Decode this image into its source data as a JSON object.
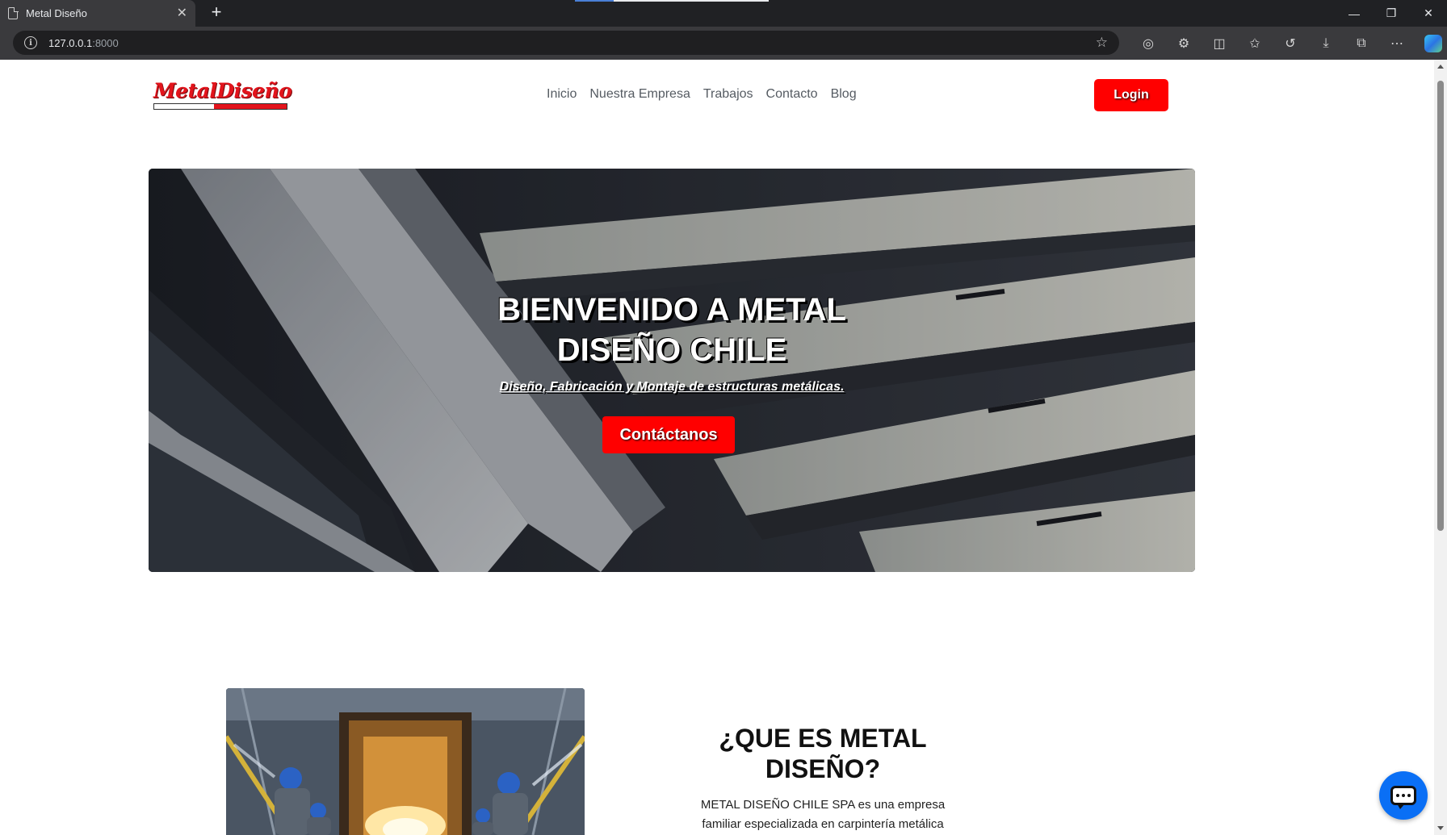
{
  "browser": {
    "tab_title": "Metal Diseño",
    "url_host": "127.0.0.1",
    "url_port": ":8000",
    "new_tab_glyph": "+",
    "close_glyph": "✕"
  },
  "icons": {
    "tab_page": "page-icon",
    "site_info": "info-icon",
    "favorite": "star-icon",
    "toolbar": [
      "tracking-icon",
      "extensions-icon",
      "split-screen-icon",
      "favorites-icon",
      "history-icon",
      "download-icon",
      "screenshot-icon",
      "more-icon",
      "copilot-icon"
    ],
    "chat": "chat-icon"
  },
  "colors": {
    "brand_red": "#ff0000",
    "logo_red": "#e3141c",
    "chat_blue": "#0a6ff5",
    "nav_text": "#555b62"
  },
  "header": {
    "logo_text": "MetalDiseño",
    "nav": [
      "Inicio",
      "Nuestra Empresa",
      "Trabajos",
      "Contacto",
      "Blog"
    ],
    "login_label": "Login"
  },
  "hero": {
    "title_line1": "BIENVENIDO A METAL",
    "title_line2": "DISEÑO CHILE",
    "subtitle": "Diseño, Fabricación y Montaje de estructuras metálicas.",
    "cta_label": "Contáctanos"
  },
  "about": {
    "title_line1": "¿QUE ES METAL",
    "title_line2": "DISEÑO?",
    "text_line1": "METAL DISEÑO CHILE SPA es una empresa",
    "text_line2": "familiar especializada en carpintería metálica"
  }
}
